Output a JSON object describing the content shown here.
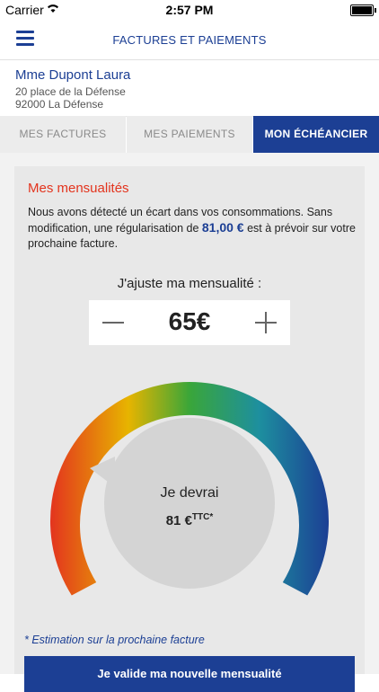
{
  "status_bar": {
    "carrier": "Carrier",
    "time": "2:57 PM"
  },
  "header": {
    "title": "FACTURES ET PAIEMENTS",
    "menu_icon": "hamburger-icon"
  },
  "client": {
    "name": "Mme Dupont Laura",
    "address_line1": "20 place de la Défense",
    "address_line2": "92000 La Défense"
  },
  "tabs": [
    {
      "label": "MES FACTURES",
      "active": false
    },
    {
      "label": "MES PAIEMENTS",
      "active": false
    },
    {
      "label": "MON ÉCHÉANCIER",
      "active": true
    }
  ],
  "section": {
    "title": "Mes mensualités",
    "message_part1": "Nous avons détecté un écart dans vos consommations. Sans modification, une régularisation de ",
    "message_amount": "81,00 €",
    "message_part2": " est à prévoir sur votre prochaine facture."
  },
  "stepper": {
    "label": "J'ajuste ma mensualité :",
    "value": "65€"
  },
  "gauge": {
    "title": "Je devrai",
    "amount": "81 €",
    "suffix": "TTC*",
    "colors": [
      "#e3341e",
      "#e7b400",
      "#3aa639",
      "#1d8f9f",
      "#1c3f94"
    ]
  },
  "footnote": "* Estimation sur la prochaine facture",
  "cta_label": "Je valide ma nouvelle mensualité",
  "colors": {
    "brand_blue": "#1c3f94",
    "accent_red": "#e3341e"
  }
}
